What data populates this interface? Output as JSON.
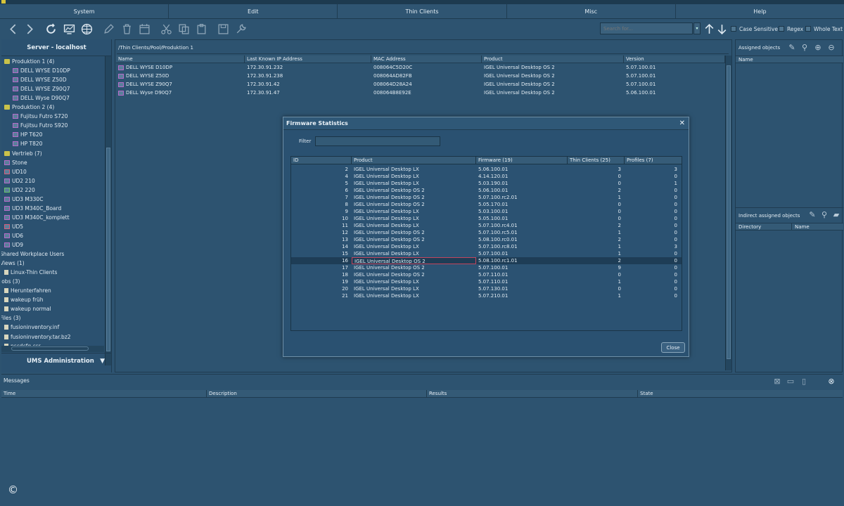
{
  "menubar": [
    "System",
    "Edit",
    "Thin Clients",
    "Misc",
    "Help"
  ],
  "toolbar": {
    "icons": [
      "back-icon",
      "forward-icon",
      "refresh-icon",
      "screen-icon",
      "globe-icon",
      "edit-icon",
      "trash-icon",
      "calendar-icon",
      "cut-icon",
      "copy-icon",
      "paste-icon",
      "save-icon",
      "tools-icon"
    ],
    "search_placeholder": "Search for...",
    "options": [
      "Case Sensitive",
      "Regex",
      "Whole Text"
    ]
  },
  "left": {
    "server_title": "Server - localhost",
    "tree": [
      {
        "label": "Produktion 1 (4)",
        "icon": "folder",
        "indent": 0
      },
      {
        "label": "DELL WYSE D10DP",
        "icon": "mon",
        "indent": 1
      },
      {
        "label": "DELL WYSE Z50D",
        "icon": "mon",
        "indent": 1
      },
      {
        "label": "DELL WYSE Z90Q7",
        "icon": "mon",
        "indent": 1
      },
      {
        "label": "DELL Wyse D90Q7",
        "icon": "mon",
        "indent": 1
      },
      {
        "label": "Produktion 2 (4)",
        "icon": "folder",
        "indent": 0
      },
      {
        "label": "Fujitsu Futro S720",
        "icon": "mon",
        "indent": 1
      },
      {
        "label": "Fujitsu Futro S920",
        "icon": "mon",
        "indent": 1
      },
      {
        "label": "HP T620",
        "icon": "mon",
        "indent": 1
      },
      {
        "label": "HP T820",
        "icon": "mon",
        "indent": 1
      },
      {
        "label": "Vertrieb (7)",
        "icon": "folder",
        "indent": 0
      },
      {
        "label": "Stone",
        "icon": "mon",
        "indent": 0
      },
      {
        "label": "UD10",
        "icon": "mon r",
        "indent": 0
      },
      {
        "label": "UD2 210",
        "icon": "mon",
        "indent": 0
      },
      {
        "label": "UD2 220",
        "icon": "mon g",
        "indent": 0
      },
      {
        "label": "UD3 M330C",
        "icon": "mon",
        "indent": 0
      },
      {
        "label": "UD3 M340C_Board",
        "icon": "mon",
        "indent": 0
      },
      {
        "label": "UD3 M340C_komplett",
        "icon": "mon",
        "indent": 0
      },
      {
        "label": "UD5",
        "icon": "mon r",
        "indent": 0
      },
      {
        "label": "UD6",
        "icon": "mon",
        "indent": 0
      },
      {
        "label": "UD9",
        "icon": "mon",
        "indent": 0
      },
      {
        "label": "Shared Workplace Users",
        "icon": "",
        "indent": -1
      },
      {
        "label": "Views (1)",
        "icon": "",
        "indent": -1
      },
      {
        "label": "Linux-Thin Clients",
        "icon": "file",
        "indent": 0
      },
      {
        "label": "Jobs (3)",
        "icon": "",
        "indent": -1
      },
      {
        "label": "Herunterfahren",
        "icon": "file",
        "indent": 0
      },
      {
        "label": "wakeup früh",
        "icon": "file",
        "indent": 0
      },
      {
        "label": "wakeup normal",
        "icon": "file",
        "indent": 0
      },
      {
        "label": "Files (3)",
        "icon": "",
        "indent": -1
      },
      {
        "label": "fusioninventory.inf",
        "icon": "file",
        "indent": 0
      },
      {
        "label": "fusioninventory.tar.bz2",
        "icon": "file",
        "indent": 0
      },
      {
        "label": "pscdcfg.csr",
        "icon": "file",
        "indent": 0
      }
    ],
    "bottom_title": "UMS Administration"
  },
  "center": {
    "breadcrumb": "/Thin Clients/Pool/Produktion 1",
    "columns": [
      "Name",
      "Last Known IP Address",
      "MAC Address",
      "Product",
      "Version"
    ],
    "rows": [
      [
        "DELL WYSE D10DP",
        "172.30.91.232",
        "008064C5D20C",
        "IGEL Universal Desktop OS 2",
        "5.07.100.01"
      ],
      [
        "DELL WYSE Z50D",
        "172.30.91.238",
        "008064AD82FB",
        "IGEL Universal Desktop OS 2",
        "5.07.100.01"
      ],
      [
        "DELL WYSE Z90Q7",
        "172.30.91.42",
        "008064D28A24",
        "IGEL Universal Desktop OS 2",
        "5.07.100.01"
      ],
      [
        "DELL Wyse D90Q7",
        "172.30.91.47",
        "008064B8E92E",
        "IGEL Universal Desktop OS 2",
        "5.06.100.01"
      ]
    ]
  },
  "right": {
    "assigned_title": "Assigned objects",
    "assigned_col": "Name",
    "indirect_title": "Indirect assigned objects",
    "indirect_cols": [
      "Directory",
      "Name"
    ]
  },
  "messages": {
    "title": "Messages",
    "columns": [
      "Time",
      "Description",
      "Results",
      "State"
    ]
  },
  "copyright": "©",
  "dialog": {
    "title": "Firmware Statistics",
    "close_glyph": "✕",
    "filter_label": "Filter",
    "columns": [
      "ID",
      "Product",
      "Firmware (19)",
      "Thin Clients (25)",
      "Profiles (7)"
    ],
    "selected_index": 13,
    "rows": [
      [
        "2",
        "IGEL Universal Desktop LX",
        "5.06.100.01",
        "3",
        "3"
      ],
      [
        "4",
        "IGEL Universal Desktop LX",
        "4.14.120.01",
        "0",
        "0"
      ],
      [
        "5",
        "IGEL Universal Desktop LX",
        "5.03.190.01",
        "0",
        "1"
      ],
      [
        "6",
        "IGEL Universal Desktop OS 2",
        "5.06.100.01",
        "2",
        "0"
      ],
      [
        "7",
        "IGEL Universal Desktop OS 2",
        "5.07.100.rc2.01",
        "1",
        "0"
      ],
      [
        "8",
        "IGEL Universal Desktop OS 2",
        "5.05.170.01",
        "0",
        "0"
      ],
      [
        "9",
        "IGEL Universal Desktop LX",
        "5.03.100.01",
        "0",
        "0"
      ],
      [
        "10",
        "IGEL Universal Desktop LX",
        "5.05.100.01",
        "0",
        "0"
      ],
      [
        "11",
        "IGEL Universal Desktop LX",
        "5.07.100.rc4.01",
        "2",
        "0"
      ],
      [
        "12",
        "IGEL Universal Desktop OS 2",
        "5.07.100.rc5.01",
        "1",
        "0"
      ],
      [
        "13",
        "IGEL Universal Desktop OS 2",
        "5.08.100.rc0.01",
        "2",
        "0"
      ],
      [
        "14",
        "IGEL Universal Desktop LX",
        "5.07.100.rc8.01",
        "1",
        "3"
      ],
      [
        "15",
        "IGEL Universal Desktop LX",
        "5.07.100.01",
        "1",
        "0"
      ],
      [
        "16",
        "IGEL Universal Desktop OS 2",
        "5.08.100.rc1.01",
        "2",
        "0"
      ],
      [
        "17",
        "IGEL Universal Desktop OS 2",
        "5.07.100.01",
        "9",
        "0"
      ],
      [
        "18",
        "IGEL Universal Desktop OS 2",
        "5.07.110.01",
        "0",
        "0"
      ],
      [
        "19",
        "IGEL Universal Desktop LX",
        "5.07.110.01",
        "1",
        "0"
      ],
      [
        "20",
        "IGEL Universal Desktop LX",
        "5.07.130.01",
        "0",
        "0"
      ],
      [
        "21",
        "IGEL Universal Desktop LX",
        "5.07.210.01",
        "1",
        "0"
      ]
    ],
    "close_label": "Close"
  }
}
